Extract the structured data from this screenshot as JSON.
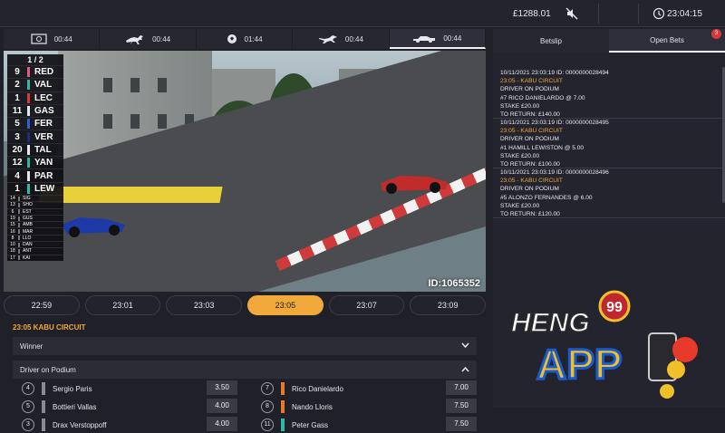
{
  "topbar": {
    "balance": "£1288.01",
    "time": "23:04:15"
  },
  "sport_tabs": [
    {
      "icon": "virtual-screen-icon",
      "time": "00:44"
    },
    {
      "icon": "horse-icon",
      "time": "00:44"
    },
    {
      "icon": "football-icon",
      "time": "01:44"
    },
    {
      "icon": "greyhound-icon",
      "time": "00:44"
    },
    {
      "icon": "f1-car-icon",
      "time": "00:44"
    }
  ],
  "video": {
    "id_label": "ID:1065352",
    "standings_page": "1 / 2",
    "standings": [
      {
        "pos": "9",
        "code": "RED",
        "color": "#e05a7a"
      },
      {
        "pos": "2",
        "code": "VAL",
        "color": "#2fb8a8"
      },
      {
        "pos": "1",
        "code": "LEC",
        "color": "#d83a3a"
      },
      {
        "pos": "11",
        "code": "GAS",
        "color": "#e6e6ec"
      },
      {
        "pos": "5",
        "code": "FER",
        "color": "#2a60d8"
      },
      {
        "pos": "3",
        "code": "VER",
        "color": "#1f2a7a"
      },
      {
        "pos": "20",
        "code": "TAL",
        "color": "#e6e6ec"
      },
      {
        "pos": "12",
        "code": "YAN",
        "color": "#2fb8a8"
      },
      {
        "pos": "4",
        "code": "PAR",
        "color": "#e6e6ec"
      },
      {
        "pos": "1",
        "code": "LEW",
        "color": "#2fb8a8"
      }
    ],
    "standings_small": [
      {
        "pos": "14",
        "code": "SIG"
      },
      {
        "pos": "13",
        "code": "SHO"
      },
      {
        "pos": "6",
        "code": "EST"
      },
      {
        "pos": "19",
        "code": "GUS"
      },
      {
        "pos": "15",
        "code": "AMB"
      },
      {
        "pos": "16",
        "code": "MAR"
      },
      {
        "pos": "8",
        "code": "LLO"
      },
      {
        "pos": "10",
        "code": "DAN"
      },
      {
        "pos": "18",
        "code": "ANT"
      },
      {
        "pos": "17",
        "code": "KAI"
      }
    ]
  },
  "race_times": [
    "22:59",
    "23:01",
    "23:03",
    "23:05",
    "23:07",
    "23:09"
  ],
  "active_race_time": "23:05",
  "race_title": "23:05 KABU CIRCUIT",
  "markets": {
    "winner": "Winner",
    "podium": "Driver on Podium"
  },
  "selections": [
    {
      "num": "4",
      "name": "Sergio Paris",
      "odds": "3.50",
      "color": "#8a8a92"
    },
    {
      "num": "7",
      "name": "Rico Danielardo",
      "odds": "7.00",
      "color": "#e87a2a"
    },
    {
      "num": "5",
      "name": "Bottieri Vallas",
      "odds": "4.00",
      "color": "#8a8a92"
    },
    {
      "num": "8",
      "name": "Nando Lloris",
      "odds": "7.50",
      "color": "#e87a2a"
    },
    {
      "num": "3",
      "name": "Drax Verstoppoff",
      "odds": "4.00",
      "color": "#8a8a92"
    },
    {
      "num": "11",
      "name": "Peter Gass",
      "odds": "7.50",
      "color": "#2fb8a8"
    }
  ],
  "betslip": {
    "tab_betslip": "Betslip",
    "tab_open": "Open Bets",
    "badge": "3",
    "bets": [
      {
        "header": "10/11/2021 23:03:19 ID: 0000000028494",
        "race": "23:05 - KABU CIRCUIT",
        "market": "DRIVER ON PODIUM",
        "pick": "#7 RICO DANIELARDO @ 7.00",
        "stake": "STAKE £20.00",
        "return": "TO RETURN: £140.00"
      },
      {
        "header": "10/11/2021 23:03:19 ID: 0000000028495",
        "race": "23:05 - KABU CIRCUIT",
        "market": "DRIVER ON PODIUM",
        "pick": "#1 HAMILL LEWISTON @ 5.00",
        "stake": "STAKE £20.00",
        "return": "TO RETURN: £100.00"
      },
      {
        "header": "10/11/2021 23:03:19 ID: 0000000028496",
        "race": "23:05 - KABU CIRCUIT",
        "market": "DRIVER ON PODIUM",
        "pick": "#5 ALONZO FERNANDES @ 6.00",
        "stake": "STAKE £20.00",
        "return": "TO RETURN: £120.00"
      }
    ]
  },
  "logo": {
    "line1": "HENG",
    "number": "99",
    "line2": "APP"
  }
}
